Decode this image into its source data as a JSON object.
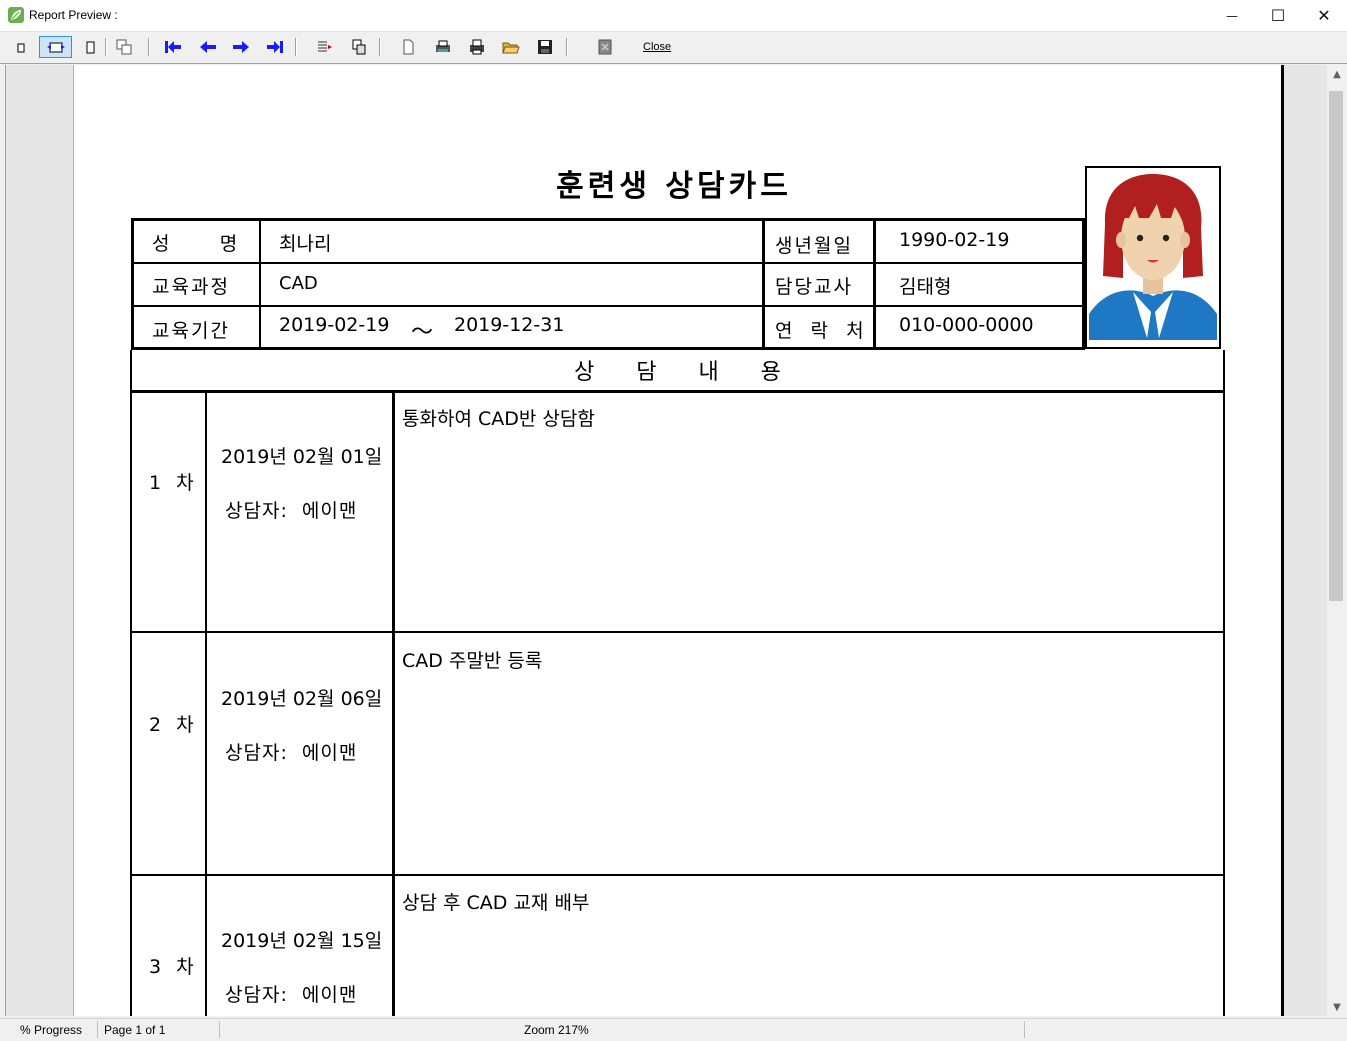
{
  "window": {
    "title": "Report Preview :",
    "minimize_glyph": "—",
    "maximize_glyph": "☐",
    "close_glyph": "✕"
  },
  "toolbar": {
    "close_label": "Close",
    "buttons": [
      "single-page-icon",
      "page-width-icon",
      "full-page-icon",
      "multi-page-icon",
      "first-page-icon",
      "previous-page-icon",
      "next-page-icon",
      "last-page-icon",
      "goto-page-icon",
      "thumbnails-icon",
      "page-setup-icon",
      "print-setup-icon",
      "print-icon",
      "open-icon",
      "save-icon",
      "export-icon"
    ]
  },
  "status": {
    "progress": "% Progress",
    "page": "Page 1 of 1",
    "zoom": "Zoom 217%"
  },
  "report": {
    "title": "훈련생 상담카드",
    "labels": {
      "name": "성      명",
      "course": "교육과정",
      "period": "교육기간",
      "birth": "생년월일",
      "teacher": "담당교사",
      "contact": "연  락  처"
    },
    "values": {
      "name": "최나리",
      "course": "CAD",
      "period_start": "2019-02-19",
      "period_sep": "～",
      "period_end": "2019-12-31",
      "birth": "1990-02-19",
      "teacher": "김태형",
      "contact": "010-000-0000"
    },
    "section_title": "상      담      내      용",
    "rows": [
      {
        "no": "1  차",
        "date": "2019년 02월 01일",
        "counselor": "상담자:  에이맨",
        "content": "통화하여 CAD반 상담함"
      },
      {
        "no": "2  차",
        "date": "2019년 02월 06일",
        "counselor": "상담자:  에이맨",
        "content": "CAD 주말반 등록"
      },
      {
        "no": "3  차",
        "date": "2019년 02월 15일",
        "counselor": "상담자:  에이맨",
        "content": "상담 후 CAD 교재 배부"
      }
    ]
  },
  "colors": {
    "accent_blue": "#1a1aff",
    "photo_hair": "#b11f1f",
    "photo_shirt": "#1f78c4",
    "photo_skin": "#f1d2ae"
  }
}
